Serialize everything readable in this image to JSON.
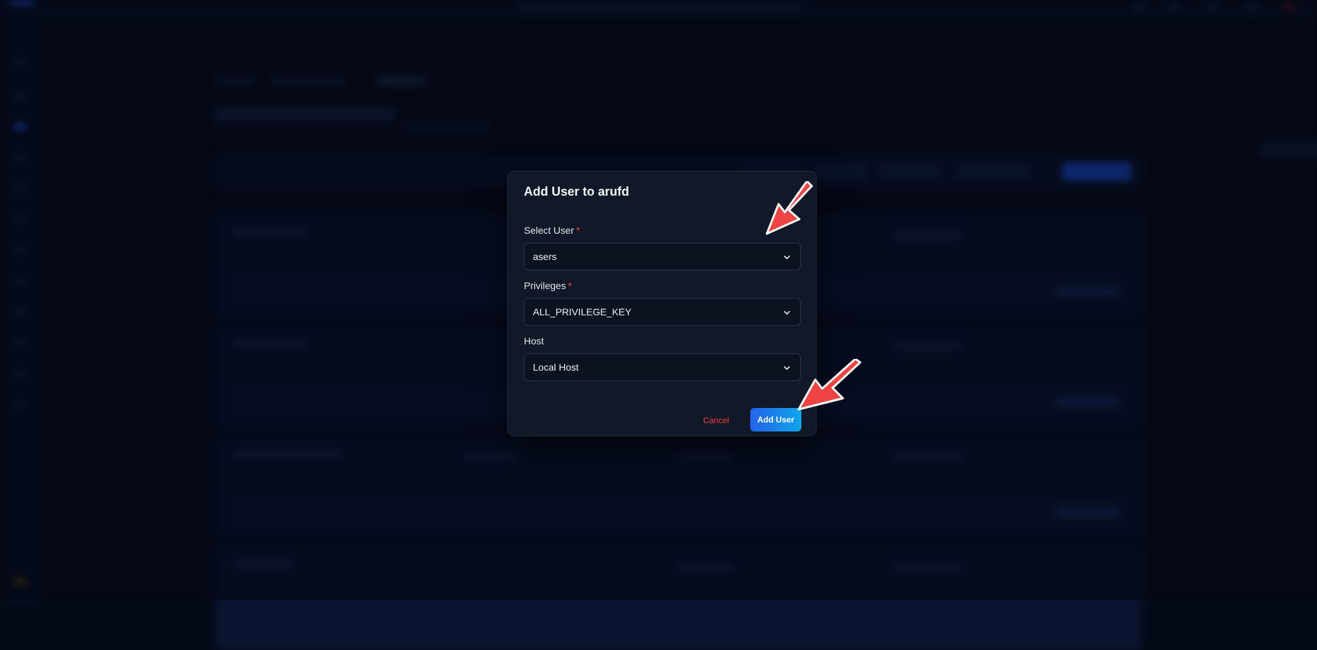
{
  "modal": {
    "title": "Add User to arufd",
    "fields": {
      "user": {
        "label": "Select User",
        "required_mark": "*",
        "value": "asers"
      },
      "privileges": {
        "label": "Privileges",
        "required_mark": "*",
        "value": "ALL_PRIVILEGE_KEY"
      },
      "host": {
        "label": "Host",
        "value": "Local Host"
      }
    },
    "actions": {
      "cancel_label": "Cancel",
      "submit_label": "Add User"
    }
  },
  "icons": {
    "select_chevron": "chevron-down-icon",
    "annotation": "red-arrow-annotation"
  },
  "colors": {
    "modal_bg": "#111827",
    "required": "#ef4444",
    "cancel": "#ef4444",
    "submit_gradient_start": "#2563eb",
    "submit_gradient_end": "#0ea5e9",
    "annotation_arrow": "#ef4444"
  }
}
